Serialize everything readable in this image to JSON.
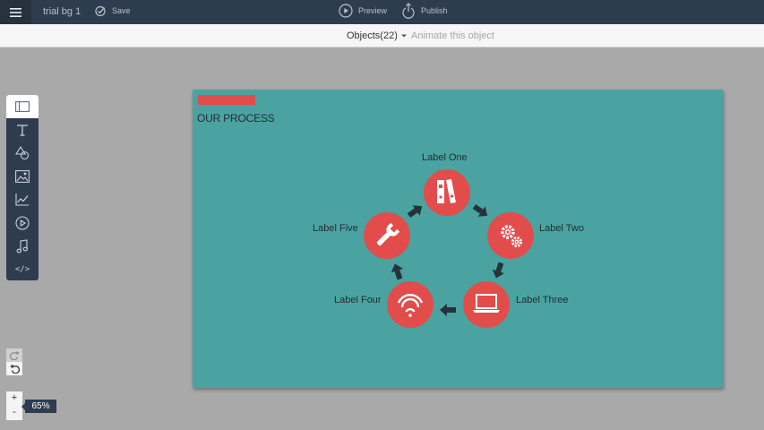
{
  "topbar": {
    "document_title": "trial bg 1",
    "save_label": "Save",
    "preview_label": "Preview",
    "publish_label": "Publish"
  },
  "subbar": {
    "objects_label": "Objects(22)",
    "animate_label": "Animate this object"
  },
  "tools": [
    {
      "icon": "slide-panel-icon"
    },
    {
      "icon": "text-icon"
    },
    {
      "icon": "shapes-icon"
    },
    {
      "icon": "image-icon"
    },
    {
      "icon": "chart-icon"
    },
    {
      "icon": "video-icon"
    },
    {
      "icon": "audio-icon"
    },
    {
      "icon": "embed-code-icon",
      "label": "</>"
    }
  ],
  "zoom": {
    "plus": "+",
    "minus": "-",
    "level": "65%"
  },
  "slide": {
    "title": "OUR PROCESS",
    "nodes": [
      {
        "label": "Label One",
        "icon": "binders-icon"
      },
      {
        "label": "Label Two",
        "icon": "gears-icon"
      },
      {
        "label": "Label Three",
        "icon": "laptop-icon"
      },
      {
        "label": "Label Four",
        "icon": "wifi-icon"
      },
      {
        "label": "Label Five",
        "icon": "wrench-icon"
      }
    ]
  },
  "colors": {
    "topbar": "#2e3c4f",
    "slide_bg": "#4aa3a1",
    "accent_red": "#e24c4b",
    "arrow": "#26323a"
  }
}
